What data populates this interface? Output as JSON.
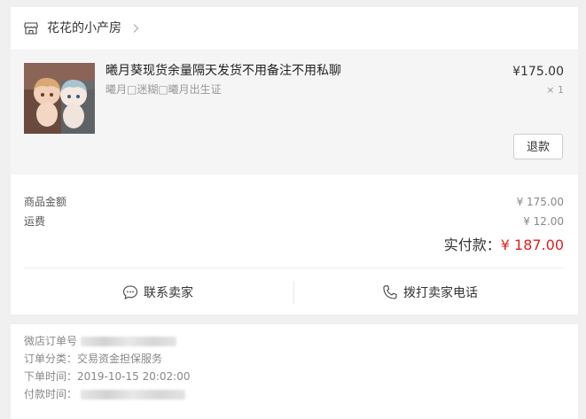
{
  "shop": {
    "name": "花花的小产房",
    "icon": "shop-icon"
  },
  "item": {
    "title": "曦月葵现货余量隔天发货不用备注不用私聊",
    "sku": "曦月□迷糊□曦月出生证",
    "price": "¥175.00",
    "qty": "× 1",
    "refund_label": "退款"
  },
  "amounts": {
    "goods_label": "商品金额",
    "goods_value": "¥ 175.00",
    "shipping_label": "运费",
    "shipping_value": "¥ 12.00",
    "paid_label": "实付款：",
    "paid_value": "¥ 187.00",
    "paid_color": "#e0201f"
  },
  "actions": {
    "contact_seller": "联系卖家",
    "call_seller": "拨打卖家电话"
  },
  "order_info": {
    "order_no_label": "微店订单号",
    "category_label": "订单分类：",
    "category_value": "交易资金担保服务",
    "order_time_label": "下单时间：",
    "order_time_value": "2019-10-15 20:02:00",
    "pay_time_label": "付款时间："
  }
}
